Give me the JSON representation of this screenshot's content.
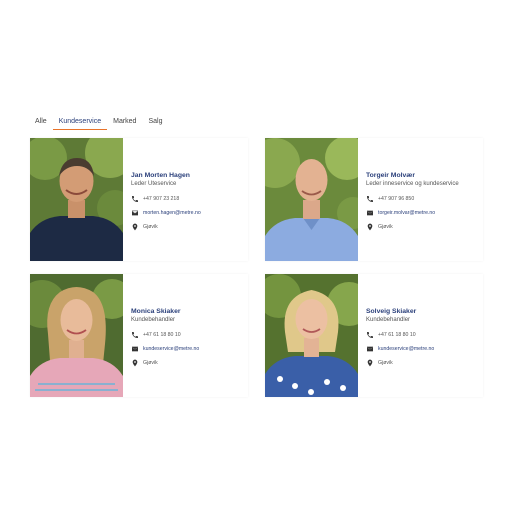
{
  "tabs": [
    {
      "label": "Alle",
      "active": false
    },
    {
      "label": "Kundeservice",
      "active": true
    },
    {
      "label": "Marked",
      "active": false
    },
    {
      "label": "Salg",
      "active": false
    }
  ],
  "accent_color": "#e8732a",
  "name_color": "#2a3f7a",
  "employees": [
    {
      "name": "Jan Morten Hagen",
      "role": "Leder Uteservice",
      "phone": "+47 907 23 218",
      "email": "morten.hagen@metre.no",
      "location": "Gjøvik"
    },
    {
      "name": "Torgeir Molvær",
      "role": "Leder inneservice og kundeservice",
      "phone": "+47 907 96 850",
      "email": "torgeir.molvar@metre.no",
      "location": "Gjøvik"
    },
    {
      "name": "Monica Skiaker",
      "role": "Kundebehandler",
      "phone": "+47 61 18 80 10",
      "email": "kundeservice@metre.no",
      "location": "Gjøvik"
    },
    {
      "name": "Solveig Skiaker",
      "role": "Kundebehandler",
      "phone": "+47 61 18 80 10",
      "email": "kundeservice@metre.no",
      "location": "Gjøvik"
    }
  ]
}
